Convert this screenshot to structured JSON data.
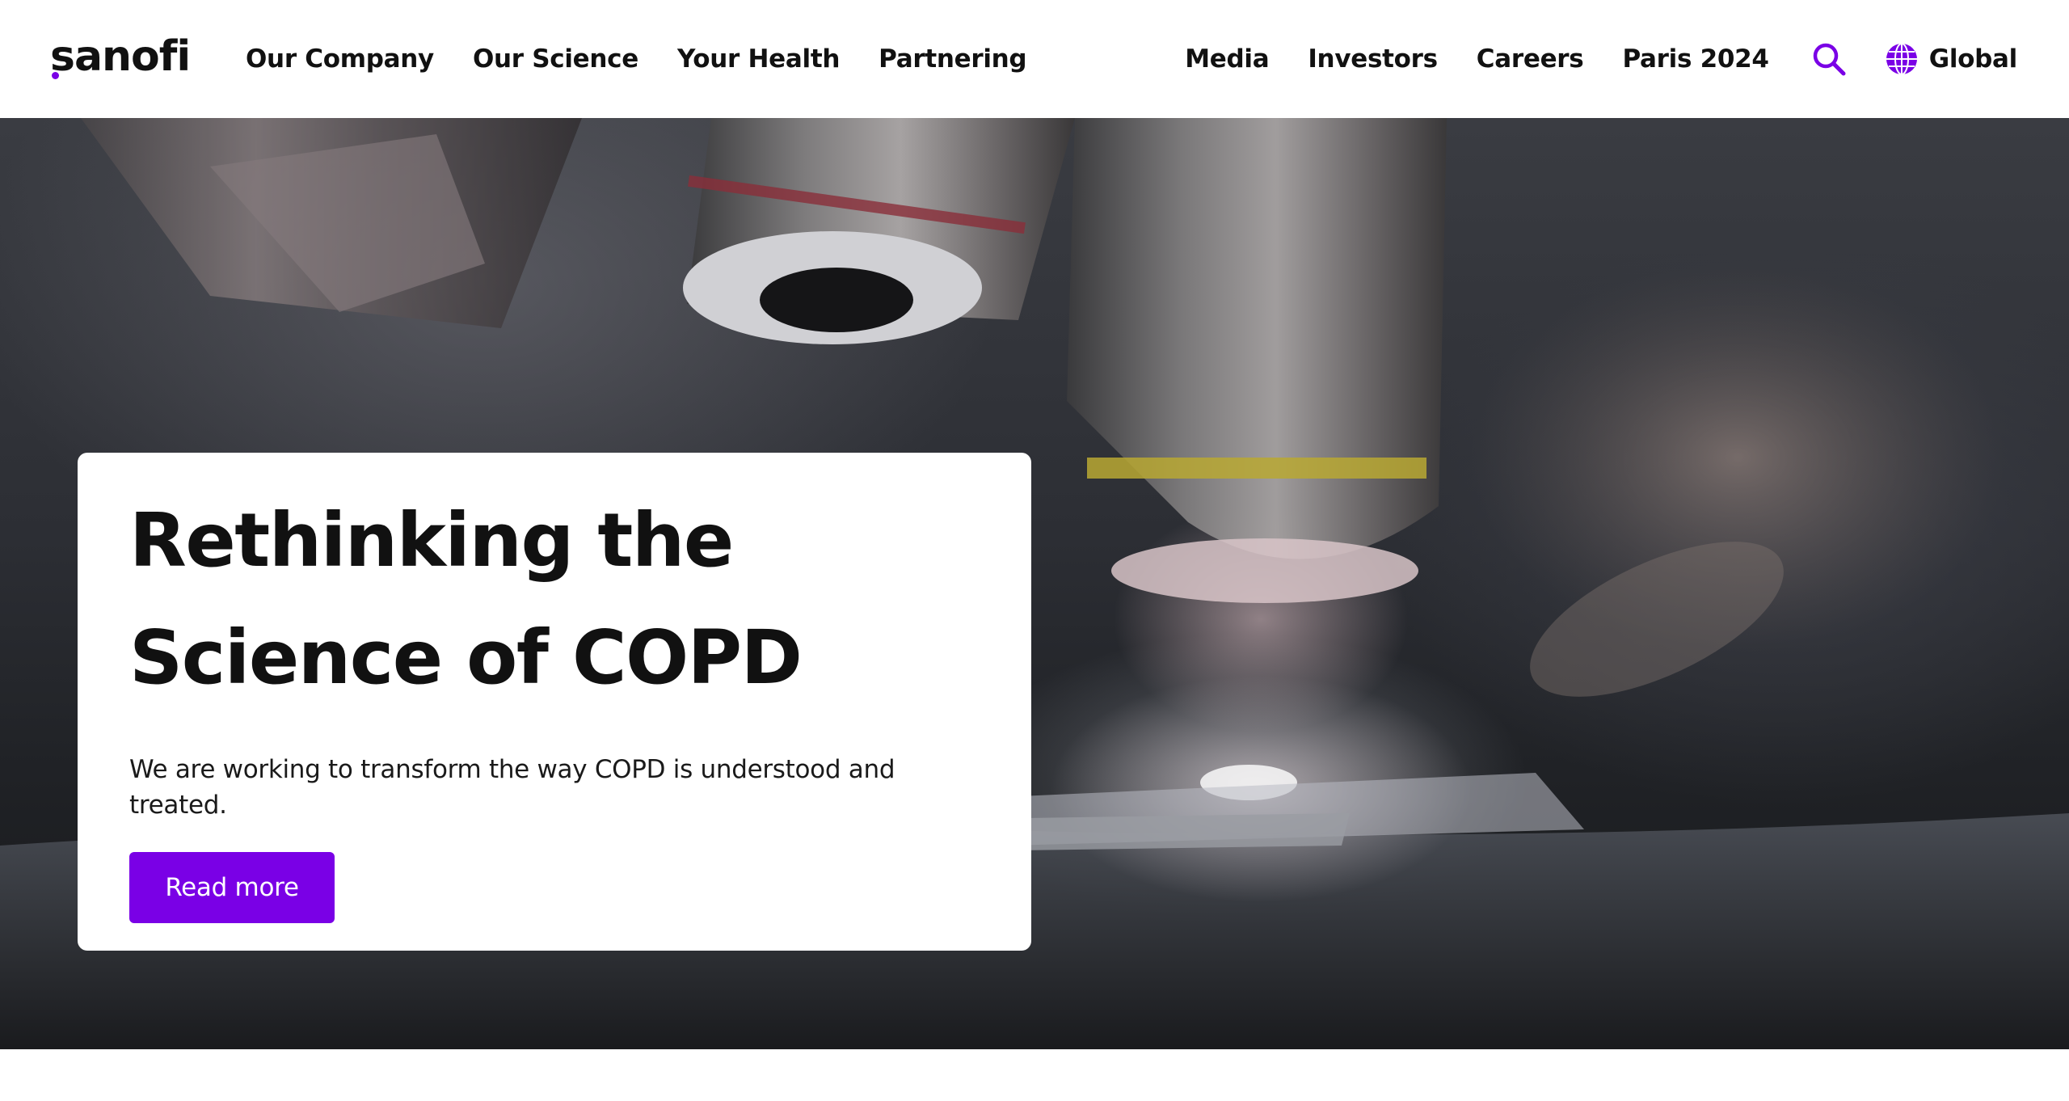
{
  "brand": {
    "logo_text": "sanofi",
    "accent_color": "#7a00e6"
  },
  "nav": {
    "primary": [
      {
        "label": "Our Company"
      },
      {
        "label": "Our Science"
      },
      {
        "label": "Your Health"
      },
      {
        "label": "Partnering"
      }
    ],
    "secondary": [
      {
        "label": "Media"
      },
      {
        "label": "Investors"
      },
      {
        "label": "Careers"
      },
      {
        "label": "Paris 2024"
      }
    ],
    "search_icon": "search-icon",
    "language": {
      "icon": "globe-icon",
      "label": "Global"
    }
  },
  "hero": {
    "title": "Rethinking the Science of COPD",
    "description": "We are working to transform the way COPD is understood and treated.",
    "cta_label": "Read more",
    "background_image": "microscope-objective-lenses-over-slide"
  }
}
